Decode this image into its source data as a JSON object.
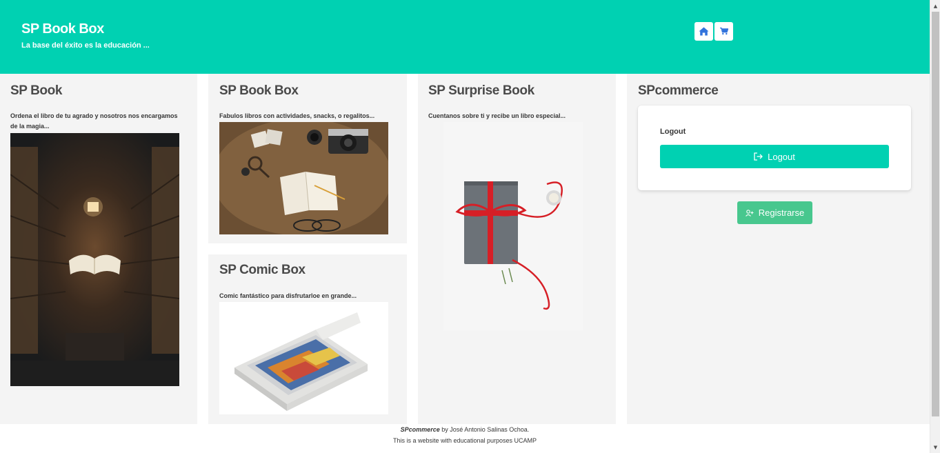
{
  "header": {
    "title": "SP Book Box",
    "subtitle": "La base del éxito es la educación ...",
    "home_icon": "home-icon",
    "cart_icon": "cart-icon",
    "color": "#00d1b2"
  },
  "columns": {
    "book": {
      "title": "SP Book",
      "description": "Ordena el libro de tu agrado y nosotros nos encargamos de la magia..."
    },
    "book_box": {
      "title": "SP Book Box",
      "description": "Fabulos libros con actividades, snacks, o regalitos..."
    },
    "comic_box": {
      "title": "SP Comic Box",
      "description": "Comic fantástico para disfrutarloe en grande..."
    },
    "surprise": {
      "title": "SP Surprise Book",
      "description": "Cuentanos sobre ti y recibe un libro especial..."
    },
    "commerce": {
      "title": "SPcommerce",
      "logout_label": "Logout",
      "logout_button": "Logout",
      "register_button": "Registrarse"
    }
  },
  "footer": {
    "brand": "SPcommerce",
    "byline": " by José Antonio Salinas Ochoa.",
    "line2": "This is a website with educational purposes UCAMP"
  },
  "colors": {
    "primary": "#00d1b2",
    "success": "#48c78e",
    "panel": "#f4f4f4"
  }
}
